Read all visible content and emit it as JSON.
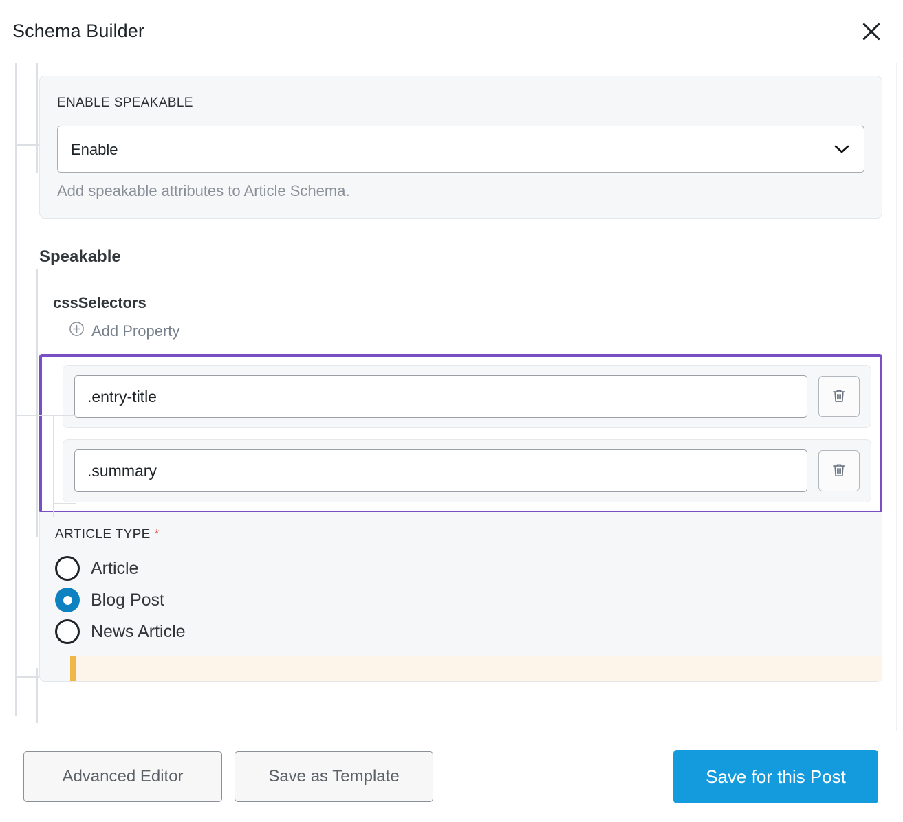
{
  "header": {
    "title": "Schema Builder",
    "close_icon": "close-icon"
  },
  "enable_speakable": {
    "label": "ENABLE SPEAKABLE",
    "select_value": "Enable",
    "options": [
      "Enable"
    ],
    "chevron_icon": "chevron-down-icon",
    "help_text": "Add speakable attributes to Article Schema."
  },
  "speakable": {
    "section_title": "Speakable",
    "property_title": "cssSelectors",
    "add_property_label": "Add Property",
    "add_icon": "plus-circle-icon",
    "selectors": [
      {
        "value": ".entry-title",
        "delete_icon": "trash-icon"
      },
      {
        "value": ".summary",
        "delete_icon": "trash-icon"
      }
    ],
    "highlight_color": "#7a4fc4"
  },
  "article_type": {
    "label": "ARTICLE TYPE",
    "required_marker": "*",
    "options": [
      {
        "label": "Article",
        "selected": false
      },
      {
        "label": "Blog Post",
        "selected": true
      },
      {
        "label": "News Article",
        "selected": false
      }
    ],
    "selected_value": "Blog Post",
    "accent_color": "#0e82c0"
  },
  "notice": {
    "accent_color": "#efb747",
    "background_color": "#fdf5e9"
  },
  "footer": {
    "advanced_editor_label": "Advanced Editor",
    "save_as_template_label": "Save as Template",
    "save_for_post_label": "Save for this Post",
    "primary_color": "#149bdd"
  }
}
